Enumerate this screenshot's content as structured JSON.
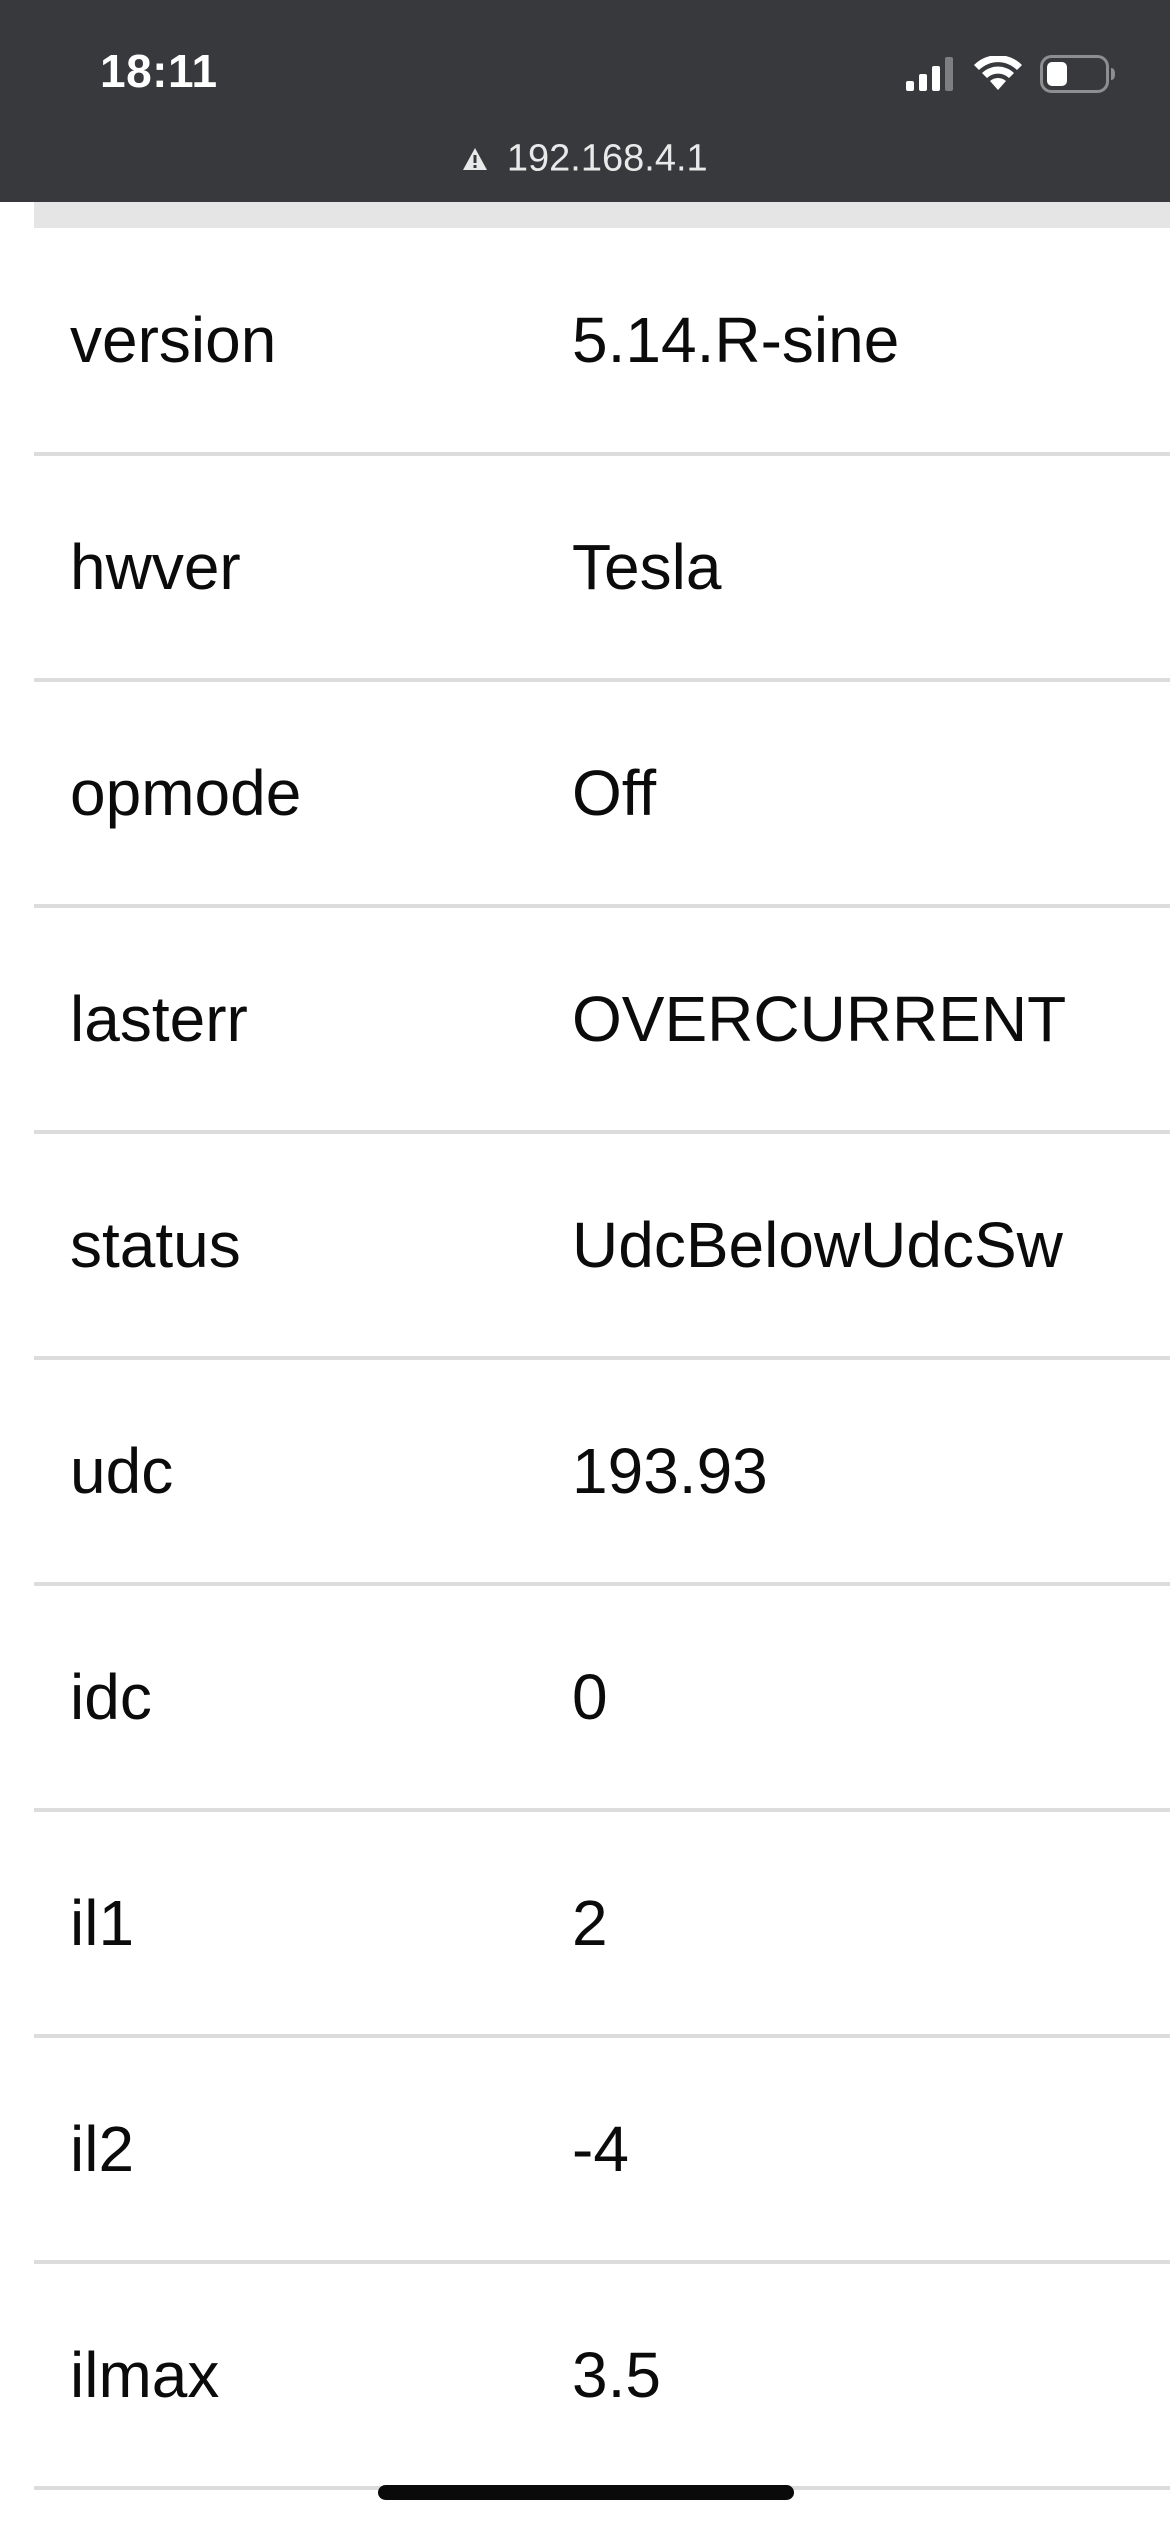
{
  "status_bar": {
    "time": "18:11",
    "icons": [
      "cellular-signal-icon",
      "wifi-icon",
      "battery-icon"
    ],
    "url": "192.168.4.1",
    "url_icon": "warning-icon"
  },
  "params": [
    {
      "name": "version",
      "value": "5.14.R-sine"
    },
    {
      "name": "hwver",
      "value": "Tesla"
    },
    {
      "name": "opmode",
      "value": "Off"
    },
    {
      "name": "lasterr",
      "value": "OVERCURRENT"
    },
    {
      "name": "status",
      "value": "UdcBelowUdcSw"
    },
    {
      "name": "udc",
      "value": "193.93"
    },
    {
      "name": "idc",
      "value": "0"
    },
    {
      "name": "il1",
      "value": "2"
    },
    {
      "name": "il2",
      "value": "-4"
    },
    {
      "name": "ilmax",
      "value": "3.5"
    }
  ],
  "colors": {
    "status_bar_bg": "#38393c",
    "row_divider": "#dcdcdc",
    "text": "#0b0b0b"
  }
}
